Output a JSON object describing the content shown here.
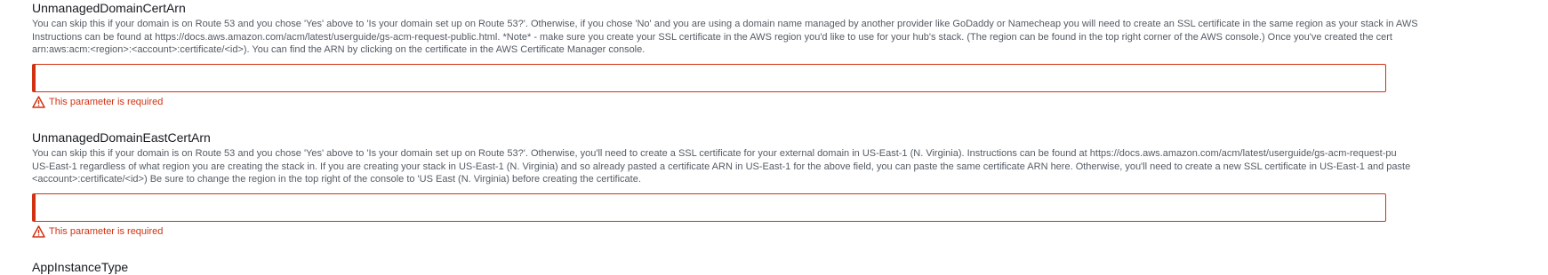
{
  "params": [
    {
      "name": "UnmanagedDomainCertArn",
      "description_lines": [
        "You can skip this if your domain is on Route 53 and you chose 'Yes' above to 'Is your domain set up on Route 53?'. Otherwise, if you chose 'No' and you are using a domain name managed by another provider like GoDaddy or Namecheap you will need to create an SSL certificate in the same region as your stack in AWS",
        "Instructions can be found at https://docs.aws.amazon.com/acm/latest/userguide/gs-acm-request-public.html. *Note* - make sure you create your SSL certificate in the AWS region you'd like to use for your hub's stack. (The region can be found in the top right corner of the AWS console.) Once you've created the cert",
        "arn:aws:acm:<region>:<account>:certificate/<id>). You can find the ARN by clicking on the certificate in the AWS Certificate Manager console."
      ],
      "value": "",
      "error": "This parameter is required"
    },
    {
      "name": "UnmanagedDomainEastCertArn",
      "description_lines": [
        "You can skip this if your domain is on Route 53 and you chose 'Yes' above to 'Is your domain set up on Route 53?'. Otherwise, you'll need to create a SSL certificate for your external domain in US-East-1 (N. Virginia). Instructions can be found at https://docs.aws.amazon.com/acm/latest/userguide/gs-acm-request-pu",
        "US-East-1 regardless of what region you are creating the stack in. If you are creating your stack in US-East-1 (N. Virginia) and so already pasted a certificate ARN in US-East-1 for the above field, you can paste the same certificate ARN here. Otherwise, you'll need to create a new SSL certificate in US-East-1 and paste",
        "<account>:certificate/<id>) Be sure to change the region in the top right of the console to 'US East (N. Virginia) before creating the certificate."
      ],
      "value": "",
      "error": "This parameter is required"
    },
    {
      "name": "AppInstanceType"
    }
  ],
  "icons": {
    "error": "warning-triangle-icon"
  },
  "colors": {
    "error": "#d13212",
    "title": "#16191f",
    "description": "#545b64"
  }
}
